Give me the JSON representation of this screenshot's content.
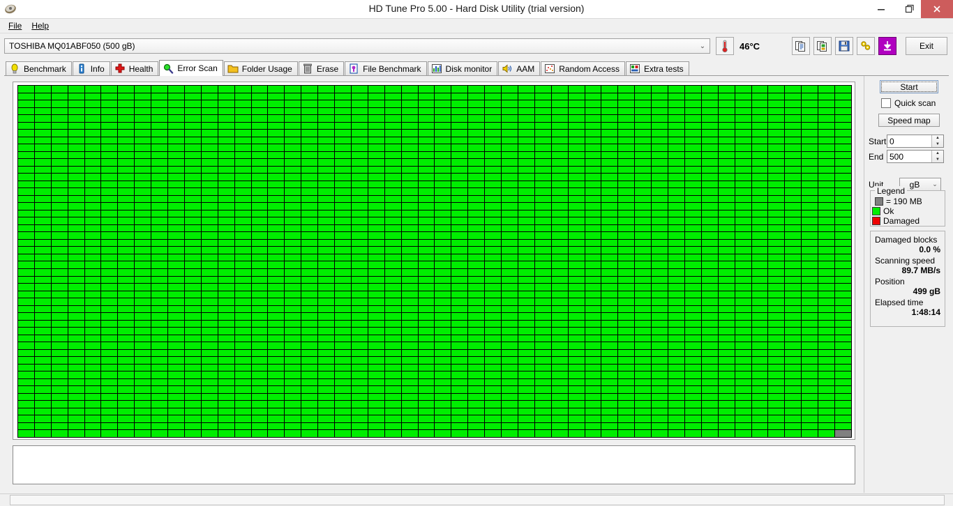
{
  "window": {
    "title": "HD Tune Pro 5.00 - Hard Disk Utility (trial version)",
    "app_icon": "hard-disk-icon",
    "minimize_label": "–",
    "maximize_label": "❐",
    "close_label": "✕",
    "close_color": "#cd5c5c"
  },
  "menu": {
    "items": [
      {
        "label": "File",
        "accel": "F"
      },
      {
        "label": "Help",
        "accel": "H"
      }
    ]
  },
  "devicebar": {
    "device": "TOSHIBA MQ01ABF050 (500 gB)",
    "dropdown_arrow": "⌄",
    "temperature": "46°C",
    "temp_icon": "thermometer-icon",
    "tools": [
      {
        "name": "copy-icon"
      },
      {
        "name": "screenshot-icon"
      },
      {
        "name": "save-icon"
      },
      {
        "name": "settings-icon"
      },
      {
        "name": "download-icon"
      }
    ],
    "exit_label": "Exit"
  },
  "tabs": [
    {
      "label": "Benchmark",
      "icon": "lightbulb-icon",
      "active": false
    },
    {
      "label": "Info",
      "icon": "info-icon",
      "active": false
    },
    {
      "label": "Health",
      "icon": "red-cross-icon",
      "active": false
    },
    {
      "label": "Error Scan",
      "icon": "magnifier-icon",
      "active": true
    },
    {
      "label": "Folder Usage",
      "icon": "folder-icon",
      "active": false
    },
    {
      "label": "Erase",
      "icon": "trashcan-icon",
      "active": false
    },
    {
      "label": "File Benchmark",
      "icon": "file-bench-icon",
      "active": false
    },
    {
      "label": "Disk monitor",
      "icon": "bar-chart-icon",
      "active": false
    },
    {
      "label": "AAM",
      "icon": "speaker-icon",
      "active": false
    },
    {
      "label": "Random Access",
      "icon": "scatter-icon",
      "active": false
    },
    {
      "label": "Extra tests",
      "icon": "extra-chart-icon",
      "active": false
    }
  ],
  "sidepanel": {
    "start_label": "Start",
    "quick_scan_label": "Quick scan",
    "quick_scan_checked": false,
    "speed_map_label": "Speed map",
    "start_field": {
      "label": "Start",
      "value": "0"
    },
    "end_field": {
      "label": "End",
      "value": "500"
    },
    "unit_field": {
      "label": "Unit",
      "value": "gB",
      "arrow": "⌄"
    },
    "legend": {
      "caption": "Legend",
      "rows": [
        {
          "label": "= 190 MB",
          "color": "#808080"
        },
        {
          "label": "Ok",
          "color": "#00ee00"
        },
        {
          "label": "Damaged",
          "color": "#ee0000"
        }
      ]
    },
    "stats": [
      {
        "label": "Damaged blocks",
        "value": "0.0 %"
      },
      {
        "label": "Scanning speed",
        "value": "89.7 MB/s"
      },
      {
        "label": "Position",
        "value": "499 gB"
      },
      {
        "label": "Elapsed time",
        "value": "1:48:14"
      }
    ]
  },
  "scan_grid": {
    "columns": 50,
    "rows": 48,
    "ok_color": "#00ee00",
    "unscanned_color": "#808080",
    "grid_line_color": "#000000",
    "unscanned_from_index": 2399
  },
  "log": {
    "text": ""
  },
  "statusbar": {
    "text": ""
  }
}
